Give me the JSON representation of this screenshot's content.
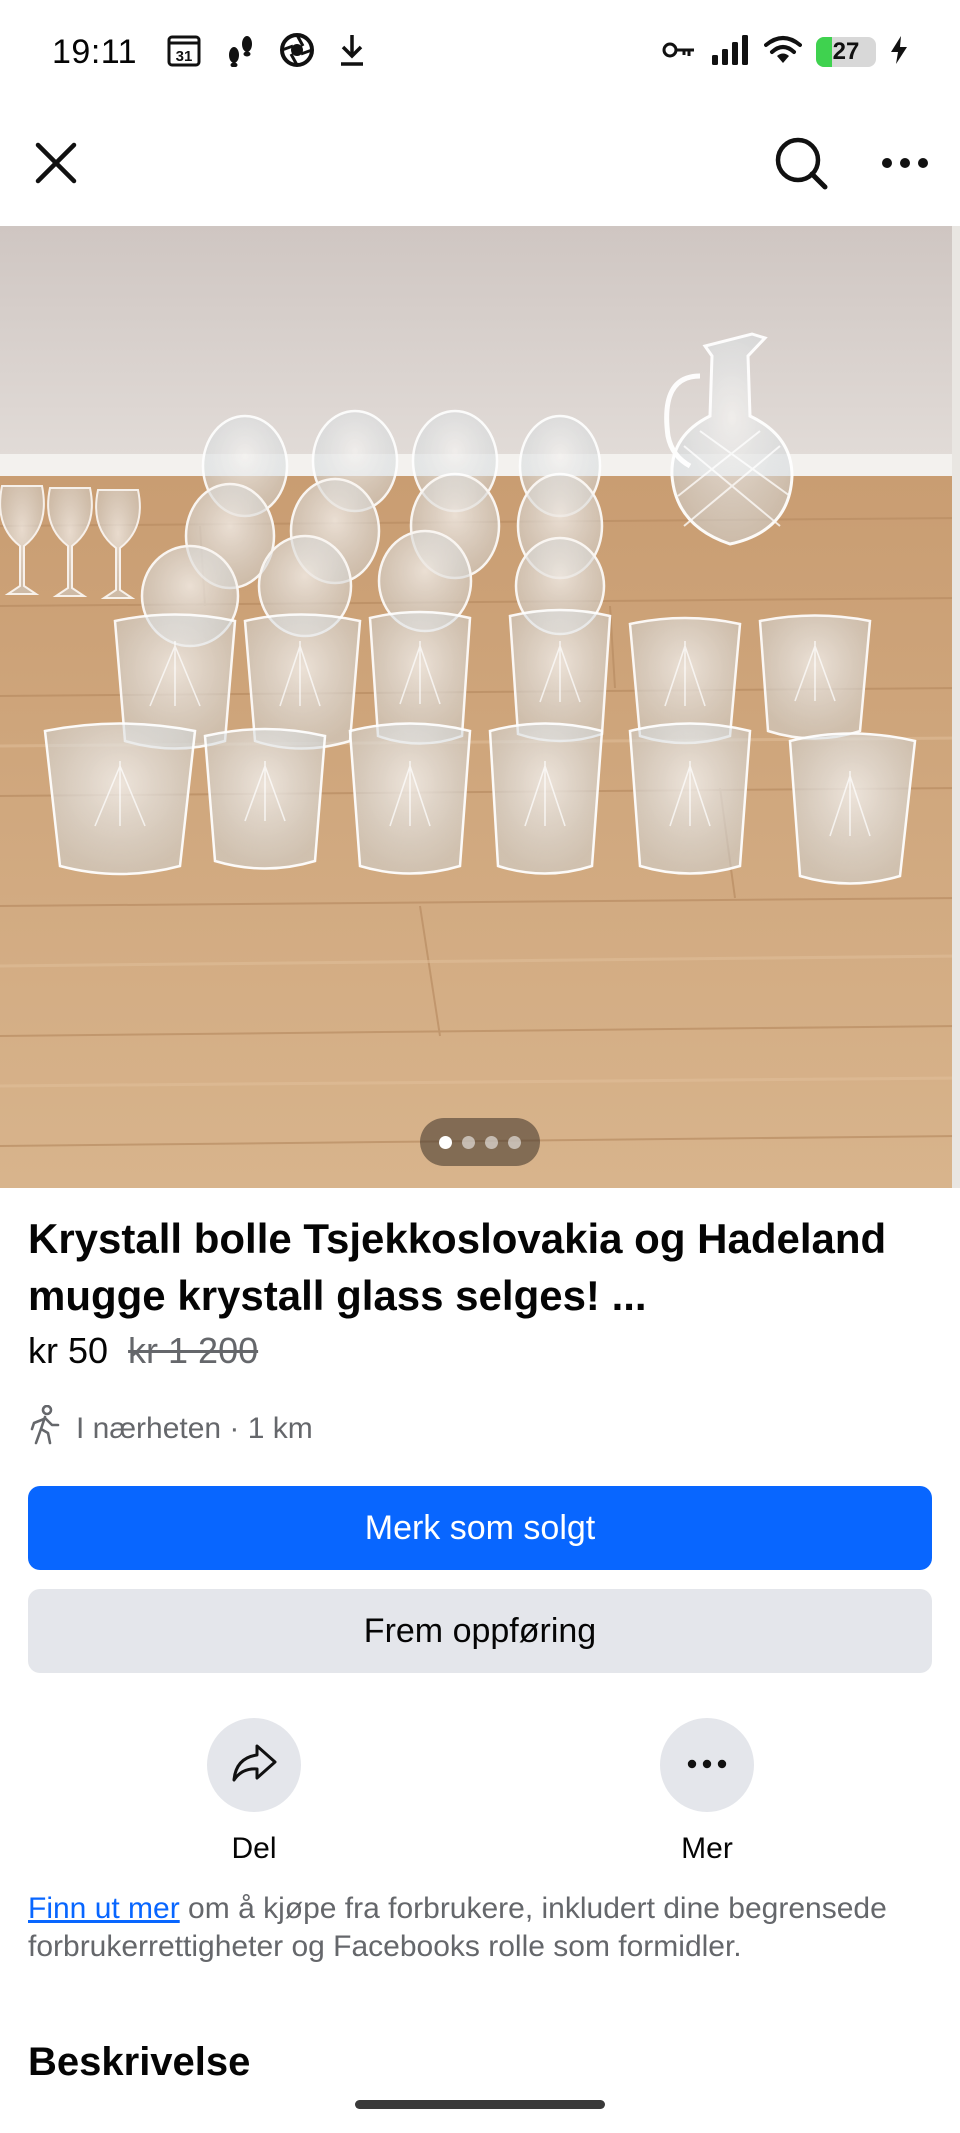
{
  "status_bar": {
    "time": "19:11",
    "calendar_day": "31",
    "battery_level": "27",
    "battery_fraction": 0.27
  },
  "top_bar": {
    "close_icon": "close-icon",
    "search_icon": "search-icon",
    "more_icon": "more-horizontal-icon"
  },
  "carousel": {
    "image_count": 4,
    "active_index": 0
  },
  "listing": {
    "title": "Krystall bolle Tsjekkoslovakia og Hadeland  mugge krystall glass selges! ...",
    "price": "kr 50",
    "original_price": "kr 1 200",
    "location": "I nærheten · 1 km"
  },
  "buttons": {
    "mark_sold": "Merk som solgt",
    "promote": "Frem oppføring"
  },
  "actions": {
    "share_label": "Del",
    "more_label": "Mer"
  },
  "info": {
    "link_text": "Finn ut mer",
    "rest_text": " om å kjøpe fra forbrukere, inkludert dine begrensede forbrukerrettigheter og Facebooks rolle som formidler."
  },
  "description": {
    "heading": "Beskrivelse"
  },
  "colors": {
    "accent": "#0866ff",
    "secondary_button": "#e4e6eb",
    "muted_text": "#65676b",
    "battery_green": "#3fd24f"
  }
}
